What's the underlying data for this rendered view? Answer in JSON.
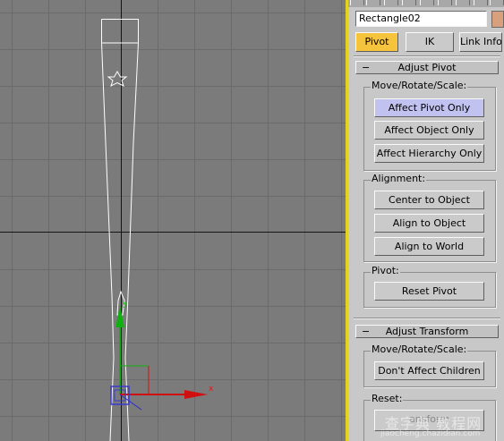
{
  "object_name": "Rectangle02",
  "object_color": "#d9a07e",
  "tabs": [
    {
      "label": "Pivot",
      "active": true
    },
    {
      "label": "IK",
      "active": false
    },
    {
      "label": "Link Info",
      "active": false
    }
  ],
  "adjust_pivot": {
    "collapse_symbol": "−",
    "title": "Adjust Pivot",
    "move_group": {
      "label": "Move/Rotate/Scale:",
      "buttons": [
        "Affect Pivot Only",
        "Affect Object Only",
        "Affect Hierarchy Only"
      ]
    },
    "alignment_group": {
      "label": "Alignment:",
      "buttons": [
        "Center to Object",
        "Align to Object",
        "Align to World"
      ]
    },
    "pivot_group": {
      "label": "Pivot:",
      "buttons": [
        "Reset Pivot"
      ]
    }
  },
  "adjust_transform": {
    "collapse_symbol": "−",
    "title": "Adjust Transform",
    "move_group": {
      "label": "Move/Rotate/Scale:",
      "buttons": [
        "Don't Affect Children"
      ]
    },
    "reset_group": {
      "label": "Reset:",
      "partial_text": "ansform"
    }
  },
  "viewport": {
    "axis_x_label": "x",
    "axis_y_label": "y",
    "axis_x_color": "#d01010",
    "axis_y_color": "#10b010",
    "selection_color": "#ffffff"
  },
  "watermark": {
    "site": "查字典 教程网",
    "url": "jiaocheng.chazidian.com"
  },
  "colors": {
    "active_tab": "#f5c43c",
    "active_button": "#c2c2f0",
    "viewport_border": "#e4d21c"
  }
}
